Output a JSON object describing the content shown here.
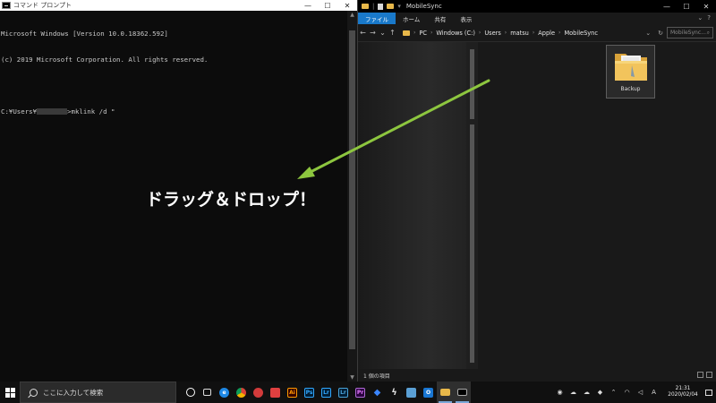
{
  "cmd": {
    "title": "コマンド プロンプト",
    "lines": [
      "Microsoft Windows [Version 10.0.18362.592]",
      "(c) 2019 Microsoft Corporation. All rights reserved."
    ],
    "prompt_prefix": "C:¥Users¥",
    "prompt_command": ">mklink /d \""
  },
  "window_controls": {
    "minimize": "—",
    "maximize": "☐",
    "close": "✕"
  },
  "explorer": {
    "title": "MobileSync",
    "ribbon_tabs": [
      "ファイル",
      "ホーム",
      "共有",
      "表示"
    ],
    "path": [
      "PC",
      "Windows (C:)",
      "Users",
      "matsu",
      "Apple",
      "MobileSync"
    ],
    "search_placeholder": "MobileSync...",
    "folder_name": "Backup",
    "status_text": "1 個の項目"
  },
  "annotation": {
    "text": "ドラッグ＆ドロップ！",
    "arrow_color": "#8dc63f"
  },
  "taskbar": {
    "search_placeholder": "ここに入力して検索",
    "apps": [
      {
        "name": "cortana",
        "label": "",
        "color": ""
      },
      {
        "name": "task-view",
        "label": "",
        "color": "#888888"
      },
      {
        "name": "edge",
        "label": "e",
        "color": "#1e88e5"
      },
      {
        "name": "chrome",
        "label": "",
        "color": "#e5a00d"
      },
      {
        "name": "app-red",
        "label": "",
        "color": "#d23b3b"
      },
      {
        "name": "app-screenshot",
        "label": "",
        "color": "#e04040"
      },
      {
        "name": "illustrator",
        "label": "Ai",
        "color": "#e87b1c"
      },
      {
        "name": "photoshop",
        "label": "Ps",
        "color": "#2a9fd6"
      },
      {
        "name": "lightroom",
        "label": "Lr",
        "color": "#3aa0d8"
      },
      {
        "name": "lightroom-classic",
        "label": "Lr",
        "color": "#4aa3d8"
      },
      {
        "name": "premiere",
        "label": "Pr",
        "color": "#b06bd6"
      },
      {
        "name": "dropbox",
        "label": "",
        "color": "#3b86ff"
      },
      {
        "name": "app-bolt",
        "label": "",
        "color": "#dddddd"
      },
      {
        "name": "app-blue",
        "label": "",
        "color": "#5a9fd4"
      },
      {
        "name": "outlook",
        "label": "O",
        "color": "#1976d2"
      },
      {
        "name": "file-explorer",
        "label": "",
        "color": "#e8b84a"
      },
      {
        "name": "command-prompt",
        "label": "",
        "color": "#555555"
      }
    ],
    "time": "21:31",
    "date": "2020/02/04",
    "ime": "A"
  }
}
